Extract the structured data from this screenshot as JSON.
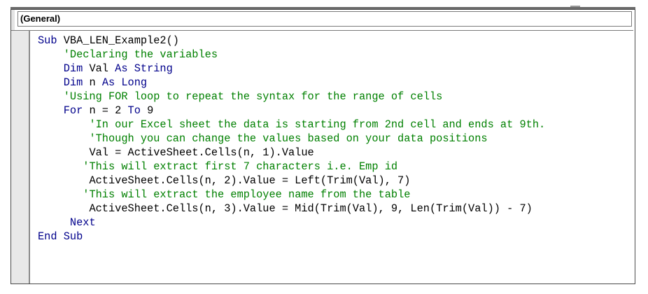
{
  "object_dropdown": {
    "label": "(General)"
  },
  "code": {
    "lines": [
      {
        "indent": 0,
        "kw1": "Sub",
        "text": " VBA_LEN_Example2()",
        "kw2": "",
        "text2": "",
        "comment": ""
      },
      {
        "indent": 4,
        "kw1": "",
        "text": "",
        "kw2": "",
        "text2": "",
        "comment": "'Declaring the variables"
      },
      {
        "indent": 4,
        "kw1": "Dim",
        "text": " Val ",
        "kw2": "As String",
        "text2": "",
        "comment": ""
      },
      {
        "indent": 4,
        "kw1": "Dim",
        "text": " n ",
        "kw2": "As Long",
        "text2": "",
        "comment": ""
      },
      {
        "indent": 4,
        "kw1": "",
        "text": "",
        "kw2": "",
        "text2": "",
        "comment": "'Using FOR loop to repeat the syntax for the range of cells"
      },
      {
        "indent": 4,
        "kw1": "For",
        "text": " n = 2 ",
        "kw2": "To",
        "text2": " 9",
        "comment": ""
      },
      {
        "indent": 8,
        "kw1": "",
        "text": "",
        "kw2": "",
        "text2": "",
        "comment": "'In our Excel sheet the data is starting from 2nd cell and ends at 9th."
      },
      {
        "indent": 8,
        "kw1": "",
        "text": "",
        "kw2": "",
        "text2": "",
        "comment": "'Though you can change the values based on your data positions"
      },
      {
        "indent": 8,
        "kw1": "",
        "text": "Val = ActiveSheet.Cells(n, 1).Value",
        "kw2": "",
        "text2": "",
        "comment": ""
      },
      {
        "indent": 7,
        "kw1": "",
        "text": "",
        "kw2": "",
        "text2": "",
        "comment": "'This will extract first 7 characters i.e. Emp id"
      },
      {
        "indent": 8,
        "kw1": "",
        "text": "ActiveSheet.Cells(n, 2).Value = Left(Trim(Val), 7)",
        "kw2": "",
        "text2": "",
        "comment": ""
      },
      {
        "indent": 7,
        "kw1": "",
        "text": "",
        "kw2": "",
        "text2": "",
        "comment": "'This will extract the employee name from the table"
      },
      {
        "indent": 8,
        "kw1": "",
        "text": "ActiveSheet.Cells(n, 3).Value = Mid(Trim(Val), 9, Len(Trim(Val)) - 7)",
        "kw2": "",
        "text2": "",
        "comment": ""
      },
      {
        "indent": 5,
        "kw1": "Next",
        "text": "",
        "kw2": "",
        "text2": "",
        "comment": ""
      },
      {
        "indent": 0,
        "kw1": "End Sub",
        "text": "",
        "kw2": "",
        "text2": "",
        "comment": ""
      }
    ]
  },
  "colors": {
    "keyword": "#00008b",
    "comment": "#008000",
    "text": "#000000"
  }
}
